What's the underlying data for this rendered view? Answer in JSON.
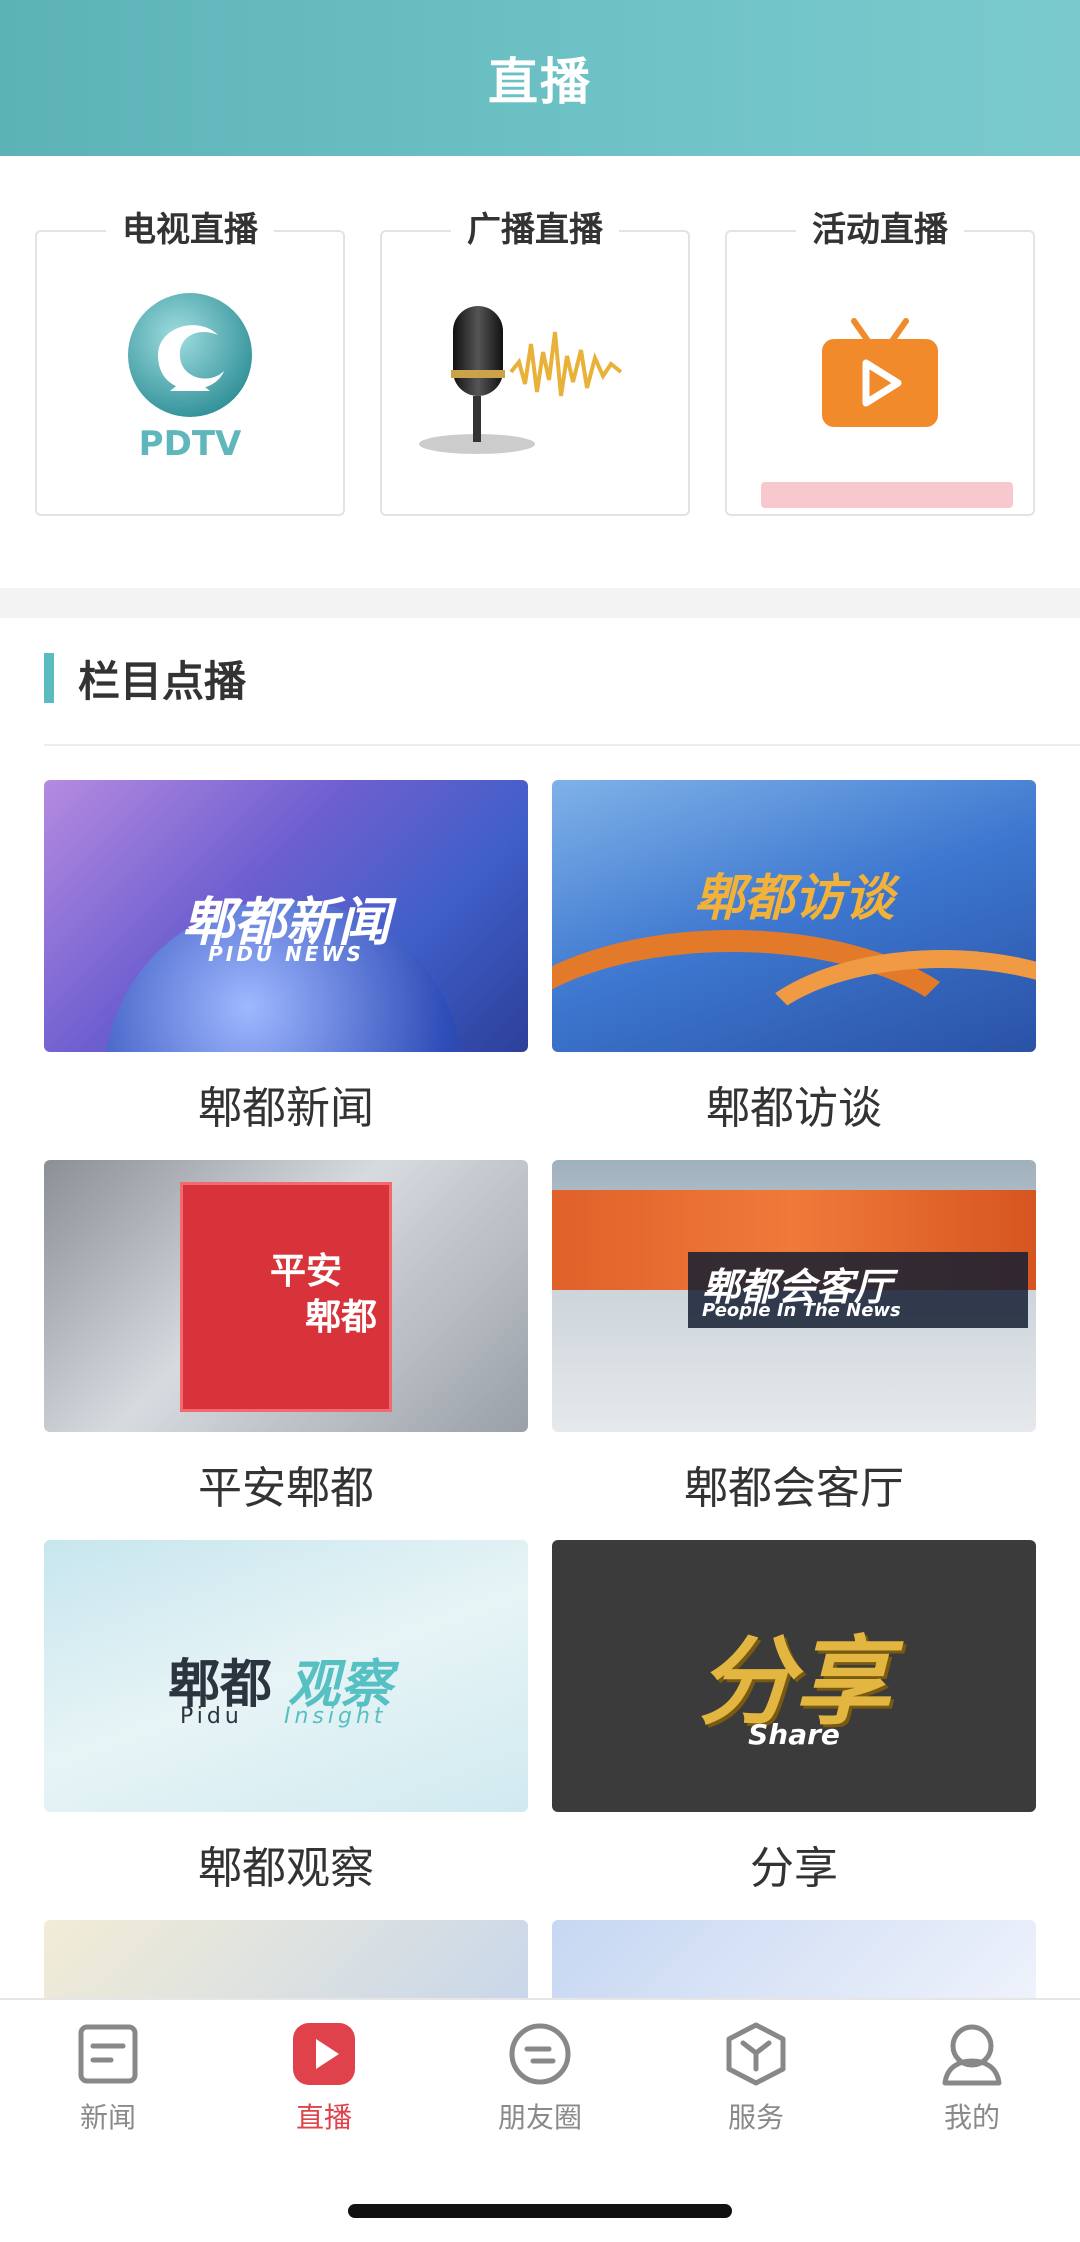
{
  "header": {
    "title": "直播"
  },
  "live": [
    {
      "label": "电视直播",
      "logo_text": "PDTV"
    },
    {
      "label": "广播直播"
    },
    {
      "label": "活动直播"
    }
  ],
  "section": {
    "title": "栏目点播"
  },
  "programs": [
    {
      "label": "郫都新闻",
      "thumb_title": "郫都新闻",
      "thumb_sub": "PIDU NEWS"
    },
    {
      "label": "郫都访谈",
      "thumb_title": "郫都访谈"
    },
    {
      "label": "平安郫都",
      "thumb_title_1": "平安",
      "thumb_title_2": "郫都"
    },
    {
      "label": "郫都会客厅",
      "thumb_title": "郫都会客厅",
      "thumb_sub": "People In The News"
    },
    {
      "label": "郫都观察",
      "thumb_title_a": "郫都",
      "thumb_title_b": "观察",
      "thumb_sub_a": "Pidu",
      "thumb_sub_b": "Insight"
    },
    {
      "label": "分享",
      "thumb_title": "分享",
      "thumb_sub": "Share"
    }
  ],
  "tabbar": {
    "items": [
      {
        "label": "新闻",
        "icon": "news-icon"
      },
      {
        "label": "直播",
        "icon": "live-play-icon"
      },
      {
        "label": "朋友圈",
        "icon": "friends-circle-icon"
      },
      {
        "label": "服务",
        "icon": "service-box-icon"
      },
      {
        "label": "我的",
        "icon": "profile-icon"
      }
    ],
    "active": "直播"
  },
  "colors": {
    "header": "#6cc0c4",
    "accent": "#5bbcc0",
    "active_tab": "#e0424b"
  }
}
